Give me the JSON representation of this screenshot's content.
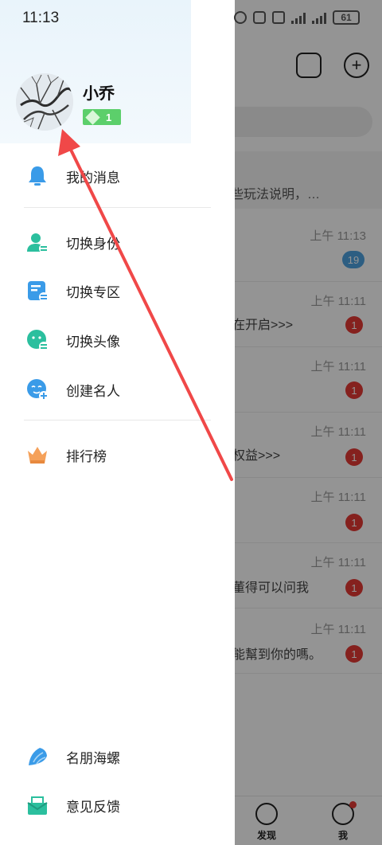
{
  "status_bar": {
    "time": "11:13",
    "battery": "61"
  },
  "drawer": {
    "user": {
      "name": "小乔",
      "level": "1"
    },
    "menu": [
      {
        "label": "我的消息",
        "icon": "bell-icon"
      },
      {
        "label": "切换身份",
        "icon": "switch-identity-icon"
      },
      {
        "label": "切换专区",
        "icon": "switch-zone-icon"
      },
      {
        "label": "切换头像",
        "icon": "switch-avatar-icon"
      },
      {
        "label": "创建名人",
        "icon": "create-celebrity-icon"
      },
      {
        "label": "排行榜",
        "icon": "crown-icon"
      }
    ],
    "bottom_menu": [
      {
        "label": "名朋海螺",
        "icon": "conch-icon"
      },
      {
        "label": "意见反馈",
        "icon": "feedback-icon"
      }
    ]
  },
  "background": {
    "notice_text": "些玩法说明，…",
    "rows": [
      {
        "time": "上午 11:13",
        "preview": "",
        "badge": "19"
      },
      {
        "time": "上午 11:11",
        "preview": "在开启>>>",
        "badge": "1"
      },
      {
        "time": "上午 11:11",
        "preview": "",
        "badge": "1"
      },
      {
        "time": "上午 11:11",
        "preview": "权益>>>",
        "badge": "1"
      },
      {
        "time": "上午 11:11",
        "preview": "",
        "badge": "1"
      },
      {
        "time": "上午 11:11",
        "preview": "董得可以问我",
        "badge": "1"
      },
      {
        "time": "上午 11:11",
        "preview": "能幫到你的嗎。",
        "badge": "1"
      }
    ],
    "tabs": {
      "discover": "发现",
      "me": "我"
    }
  },
  "colors": {
    "accent": "#2bbf9e",
    "annotation": "#f04848"
  }
}
